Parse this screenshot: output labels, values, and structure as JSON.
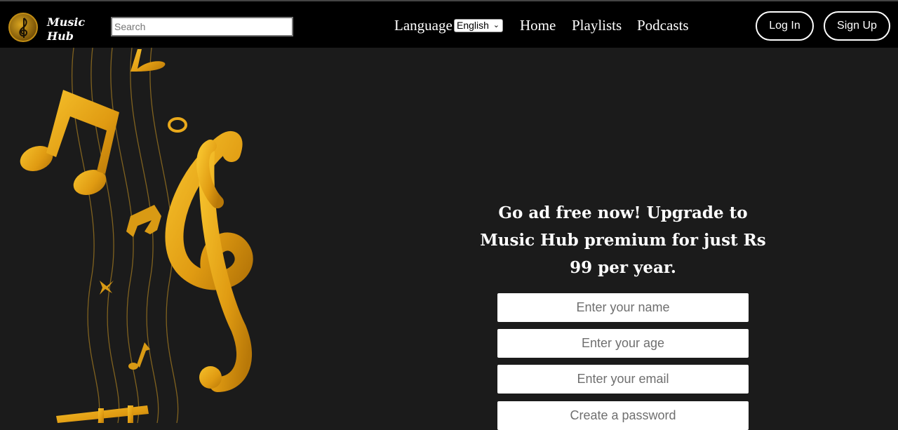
{
  "brand": {
    "line1": "Music",
    "line2": "Hub",
    "logo_icon": "treble-clef-icon"
  },
  "search": {
    "placeholder": "Search",
    "value": ""
  },
  "nav": {
    "language_label": "Language",
    "language_selected": "English",
    "home": "Home",
    "playlists": "Playlists",
    "podcasts": "Podcasts"
  },
  "auth": {
    "login": "Log In",
    "signup": "Sign Up"
  },
  "promo": {
    "text": "Go ad free now! Upgrade to Music Hub premium for just Rs 99 per year."
  },
  "form": {
    "name_placeholder": "Enter your name",
    "age_placeholder": "Enter your age",
    "email_placeholder": "Enter your email",
    "password_placeholder": "Create a password"
  },
  "colors": {
    "accent_gold": "#e6a81a",
    "background": "#1b1b1b",
    "navbar": "#000000"
  }
}
